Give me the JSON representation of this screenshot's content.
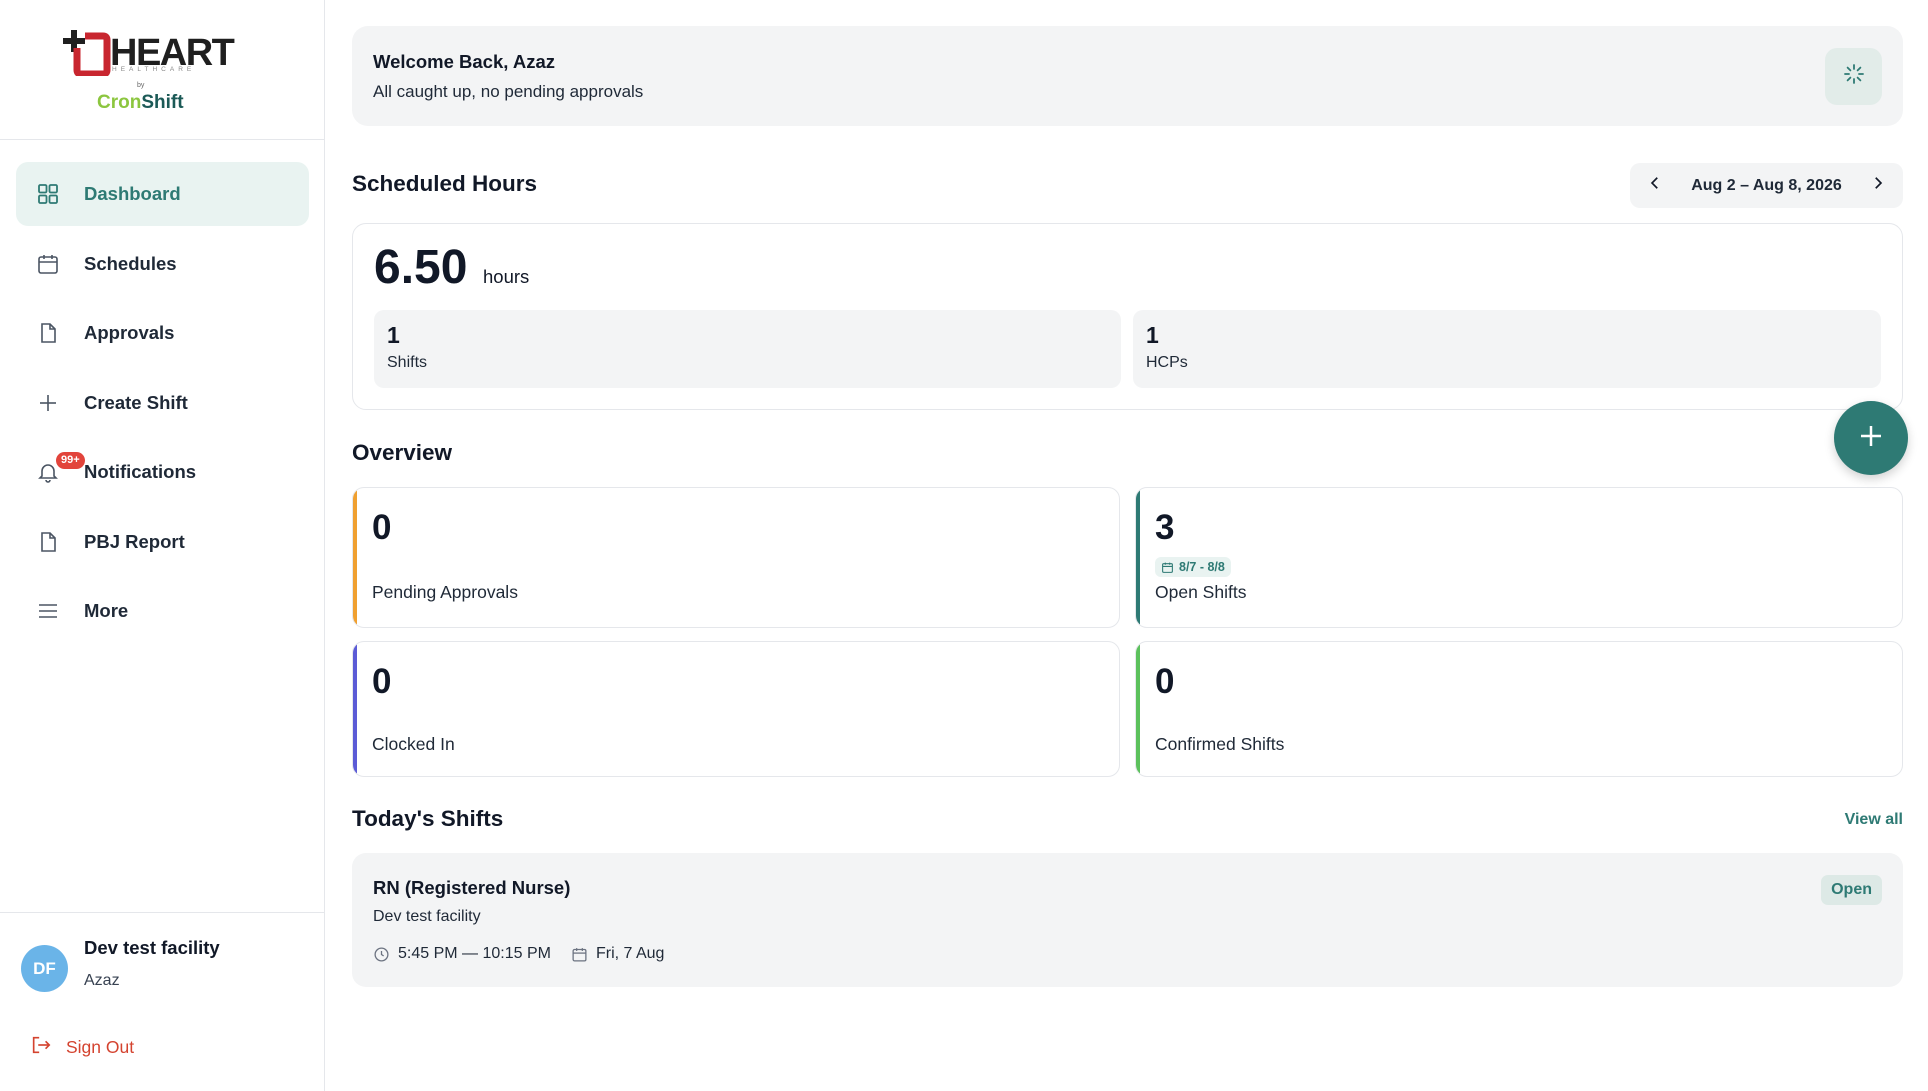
{
  "brand": {
    "logo_word": "HEART",
    "logo_sub": "HEALTHCARE",
    "logo_by": "by",
    "cron_part1": "Cron",
    "cron_part2": "Shift",
    "color_red": "#c8262f",
    "color_teal": "#2e7a74",
    "color_green": "#8cc63f"
  },
  "sidebar": {
    "items": [
      {
        "label": "Dashboard",
        "icon": "grid-icon",
        "active": true
      },
      {
        "label": "Schedules",
        "icon": "calendar-icon"
      },
      {
        "label": "Approvals",
        "icon": "document-icon"
      },
      {
        "label": "Create Shift",
        "icon": "plus-icon"
      },
      {
        "label": "Notifications",
        "icon": "bell-icon",
        "badge": "99+"
      },
      {
        "label": "PBJ Report",
        "icon": "document-icon"
      },
      {
        "label": "More",
        "icon": "menu-icon"
      }
    ],
    "footer": {
      "avatar_initials": "DF",
      "facility_name": "Dev test facility",
      "user_name": "Azaz",
      "sign_out": "Sign Out"
    }
  },
  "welcome": {
    "title": "Welcome Back, Azaz",
    "subtitle": "All caught up, no pending approvals"
  },
  "scheduled_hours": {
    "title": "Scheduled Hours",
    "date_range": "Aug 2 – Aug 8, 2026",
    "hours_value": "6.50",
    "hours_unit": "hours",
    "shifts_value": "1",
    "shifts_label": "Shifts",
    "hcps_value": "1",
    "hcps_label": "HCPs"
  },
  "overview": {
    "title": "Overview",
    "cards": [
      {
        "value": "0",
        "label": "Pending Approvals",
        "accent": "#f0a030"
      },
      {
        "value": "3",
        "label": "Open Shifts",
        "accent": "#2e7a74",
        "chip": "8/7 - 8/8"
      },
      {
        "value": "0",
        "label": "Clocked In",
        "accent": "#5b5bd6"
      },
      {
        "value": "0",
        "label": "Confirmed Shifts",
        "accent": "#5cc15c"
      }
    ]
  },
  "todays_shifts": {
    "title": "Today's Shifts",
    "view_all": "View all",
    "items": [
      {
        "role": "RN (Registered Nurse)",
        "facility": "Dev test facility",
        "time": "5:45 PM — 10:15 PM",
        "date": "Fri, 7 Aug",
        "status": "Open"
      }
    ]
  }
}
